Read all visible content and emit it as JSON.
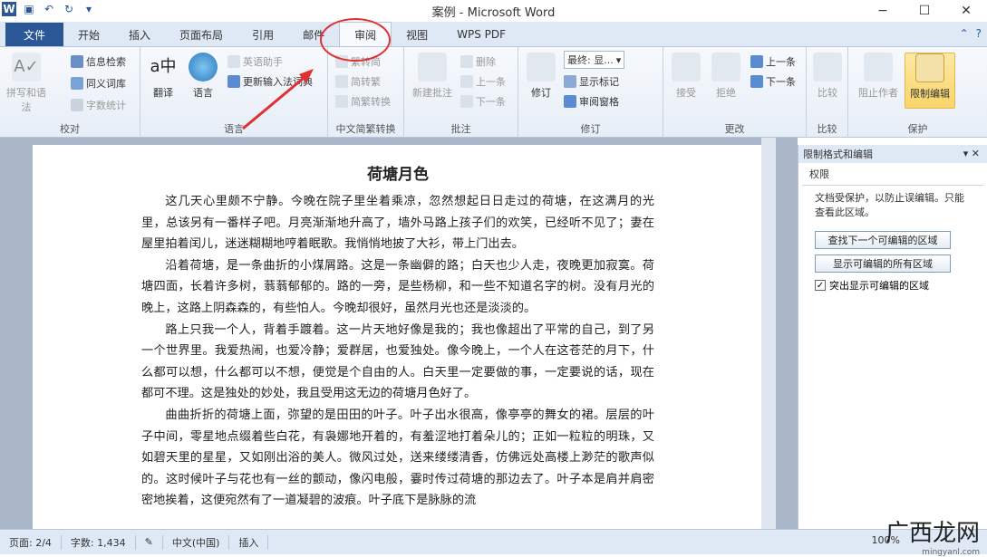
{
  "window": {
    "title": "案例 - Microsoft Word",
    "qat": [
      "word-icon",
      "save-icon",
      "undo-icon",
      "redo-icon",
      "customize-icon"
    ],
    "controls": [
      "−",
      "☐",
      "✕"
    ]
  },
  "tabs": [
    {
      "label": "文件"
    },
    {
      "label": "开始"
    },
    {
      "label": "插入"
    },
    {
      "label": "页面布局"
    },
    {
      "label": "引用"
    },
    {
      "label": "邮件"
    },
    {
      "label": "审阅"
    },
    {
      "label": "视图"
    },
    {
      "label": "WPS PDF"
    }
  ],
  "active_tab": "审阅",
  "ribbon": {
    "proofing": {
      "label": "校对",
      "spell": "拼写和语法",
      "research": "信息检索",
      "thesaurus": "同义词库",
      "wordcount": "字数统计"
    },
    "language": {
      "label": "语言",
      "translate": "翻译",
      "language": "语言",
      "english_assistant": "英语助手",
      "update_ime": "更新输入法词典"
    },
    "chinese": {
      "label": "中文简繁转换",
      "t2s": "繁转简",
      "s2t": "简转繁",
      "convert": "简繁转换"
    },
    "comments": {
      "label": "批注",
      "new": "新建批注",
      "delete": "删除",
      "prev": "上一条",
      "next": "下一条"
    },
    "tracking": {
      "label": "修订",
      "track": "修订",
      "final": "最终: 显...",
      "show_markup": "显示标记",
      "review_pane": "审阅窗格"
    },
    "changes": {
      "label": "更改",
      "accept": "接受",
      "reject": "拒绝",
      "prev": "上一条",
      "next": "下一条"
    },
    "compare": {
      "label": "比较",
      "compare": "比较"
    },
    "protect": {
      "label": "保护",
      "block": "阻止作者",
      "restrict": "限制编辑"
    }
  },
  "document": {
    "title": "荷塘月色",
    "paragraphs": [
      "这几天心里颇不宁静。今晚在院子里坐着乘凉，忽然想起日日走过的荷塘，在这满月的光里，总该另有一番样子吧。月亮渐渐地升高了，墙外马路上孩子们的欢笑，已经听不见了；妻在屋里拍着闰儿，迷迷糊糊地哼着眠歌。我悄悄地披了大衫，带上门出去。",
      "沿着荷塘，是一条曲折的小煤屑路。这是一条幽僻的路；白天也少人走，夜晚更加寂寞。荷塘四面，长着许多树，蓊蓊郁郁的。路的一旁，是些杨柳，和一些不知道名字的树。没有月光的晚上，这路上阴森森的，有些怕人。今晚却很好，虽然月光也还是淡淡的。",
      "路上只我一个人，背着手踱着。这一片天地好像是我的；我也像超出了平常的自己，到了另一个世界里。我爱热闹，也爱冷静；爱群居，也爱独处。像今晚上，一个人在这苍茫的月下，什么都可以想，什么都可以不想，便觉是个自由的人。白天里一定要做的事，一定要说的话，现在都可不理。这是独处的妙处，我且受用这无边的荷塘月色好了。",
      "曲曲折折的荷塘上面，弥望的是田田的叶子。叶子出水很高，像亭亭的舞女的裙。层层的叶子中间，零星地点缀着些白花，有袅娜地开着的，有羞涩地打着朵儿的；正如一粒粒的明珠，又如碧天里的星星，又如刚出浴的美人。微风过处，送来缕缕清香，仿佛远处高楼上渺茫的歌声似的。这时候叶子与花也有一丝的颤动，像闪电般，霎时传过荷塘的那边去了。叶子本是肩并肩密密地挨着，这便宛然有了一道凝碧的波痕。叶子底下是脉脉的流"
    ]
  },
  "pane": {
    "title": "限制格式和编辑",
    "section": "权限",
    "info": "文档受保护，以防止误编辑。只能查看此区域。",
    "find_next": "查找下一个可编辑的区域",
    "show_all": "显示可编辑的所有区域",
    "highlight": "突出显示可编辑的区域",
    "highlight_checked": true
  },
  "status": {
    "page": "页面: 2/4",
    "words": "字数: 1,434",
    "lang": "中文(中国)",
    "mode": "插入",
    "zoom": "100%"
  },
  "watermark": {
    "brand": "广西龙网",
    "url": "mingyanl.com"
  },
  "colors": {
    "accent": "#2b5797",
    "annotation": "#e03030",
    "highlight": "#f9d46a"
  }
}
